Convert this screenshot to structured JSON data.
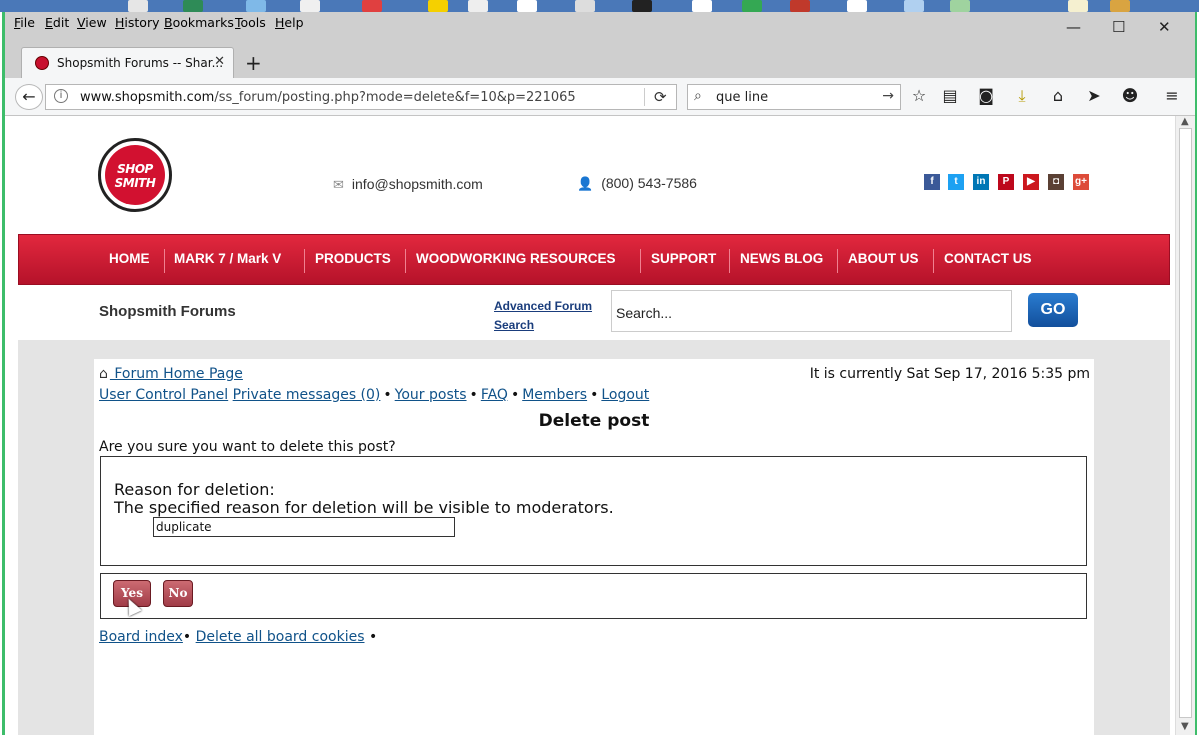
{
  "menubar": {
    "items": [
      {
        "ul": "F",
        "rest": "ile"
      },
      {
        "ul": "E",
        "rest": "dit"
      },
      {
        "ul": "V",
        "rest": "iew"
      },
      {
        "ul": "H",
        "rest": "istory"
      },
      {
        "ul": "B",
        "rest": "ookmarks"
      },
      {
        "ul": "T",
        "rest": "ools"
      },
      {
        "ul": "H",
        "rest": "elp"
      }
    ]
  },
  "window_controls": {
    "minimize": "—",
    "maximize": "☐",
    "close": "✕"
  },
  "tab": {
    "title": "Shopsmith Forums -- Shar...",
    "close": "✕",
    "new": "+"
  },
  "address": {
    "host": "www.shopsmith.com",
    "path": "/ss_forum/posting.php?mode=delete&f=10&p=221065"
  },
  "search_bar": {
    "query": "que line"
  },
  "site": {
    "logo_line1": "SHOP",
    "logo_line2": "SMITH",
    "email": "info@shopsmith.com",
    "phone": "(800) 543-7586",
    "social": [
      {
        "name": "facebook",
        "glyph": "f",
        "color": "#3b5998"
      },
      {
        "name": "twitter",
        "glyph": "t",
        "color": "#1da1f2"
      },
      {
        "name": "linkedin",
        "glyph": "in",
        "color": "#0077b5"
      },
      {
        "name": "pinterest",
        "glyph": "P",
        "color": "#bd081c"
      },
      {
        "name": "youtube",
        "glyph": "▶",
        "color": "#cc181e"
      },
      {
        "name": "instagram",
        "glyph": "◘",
        "color": "#5b4034"
      },
      {
        "name": "googleplus",
        "glyph": "g+",
        "color": "#dd4b39"
      }
    ],
    "nav": [
      "HOME",
      "MARK 7 / Mark V",
      "PRODUCTS",
      "WOODWORKING RESOURCES",
      "SUPPORT",
      "NEWS BLOG",
      "ABOUT US",
      "CONTACT US"
    ],
    "forums_heading": "Shopsmith Forums",
    "advanced_search_line1": "Advanced Forum",
    "advanced_search_line2": "Search",
    "search_placeholder": "Search...",
    "go_label": "GO"
  },
  "forum": {
    "home_link": " Forum Home Page",
    "current_time": "It is currently Sat Sep 17, 2016 5:35 pm",
    "links": [
      "User Control Panel",
      "Private messages (0)",
      "Your posts",
      "FAQ",
      "Members",
      "Logout"
    ],
    "page_title": "Delete post",
    "question": "Are you sure you want to delete this post?",
    "reason_label": "Reason for deletion:",
    "reason_note": "The specified reason for deletion will be visible to moderators.",
    "reason_value": "duplicate",
    "yes_label": "Yes",
    "no_label": "No",
    "footer": [
      "Board index",
      "Delete all board cookies"
    ]
  }
}
